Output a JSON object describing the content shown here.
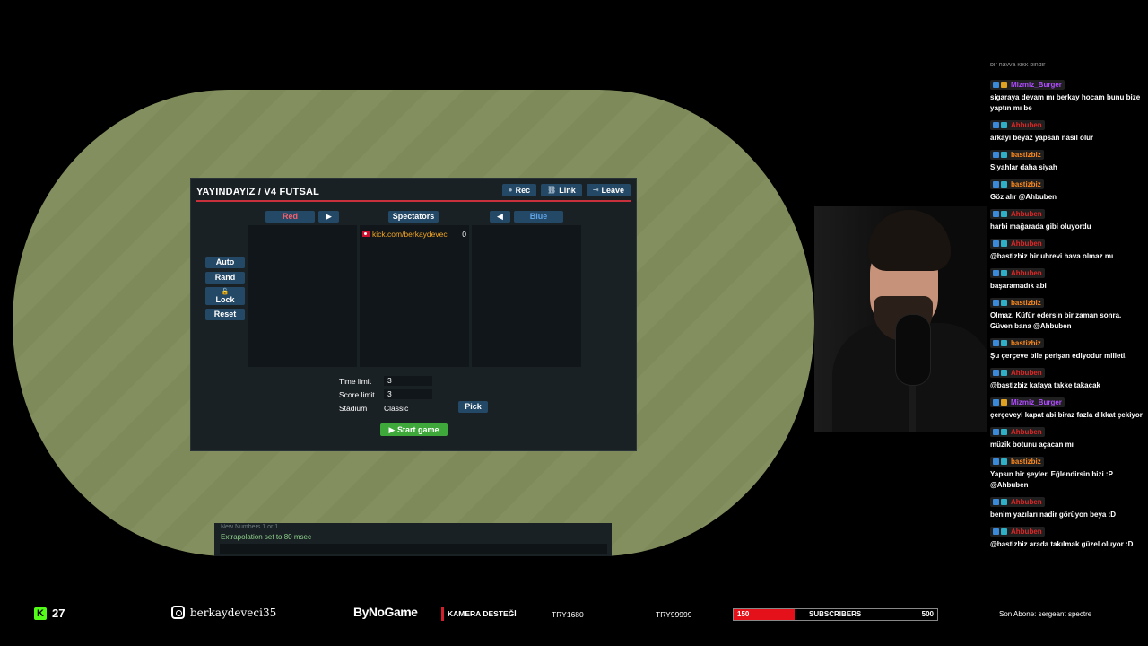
{
  "room": {
    "title": "YAYINDAYIZ / V4 FUTSAL",
    "buttons": {
      "rec": "Rec",
      "link": "Link",
      "leave": "Leave"
    },
    "teams": {
      "red": "Red",
      "spectators": "Spectators",
      "blue": "Blue",
      "red_arrow": "▶",
      "blue_arrow": "◀"
    },
    "spectators": [
      {
        "name": "kick.com/berkaydeveci",
        "score": "0"
      }
    ],
    "side_buttons": {
      "auto": "Auto",
      "rand": "Rand",
      "lock": "Lock",
      "reset": "Reset"
    },
    "options": {
      "time_limit_label": "Time limit",
      "time_limit": "3",
      "score_limit_label": "Score limit",
      "score_limit": "3",
      "stadium_label": "Stadium",
      "stadium": "Classic",
      "pick": "Pick"
    },
    "start": "▶ Start game"
  },
  "log": {
    "line1": "New Numbers 1 or 1",
    "line2": "Extrapolation set to 80 msec"
  },
  "chat": {
    "top": "bir havva kikk bindir",
    "messages": [
      {
        "user": "Mizmiz_Burger",
        "color": "purple",
        "text": "sigaraya devam mı berkay hocam bunu bize yaptın mı be"
      },
      {
        "user": "Ahbuben",
        "color": "red",
        "text": "arkayı beyaz yapsan nasıl olur"
      },
      {
        "user": "bastizbiz",
        "color": "orange",
        "text": "Siyahlar daha siyah"
      },
      {
        "user": "bastizbiz",
        "color": "orange",
        "text": "Göz alır @Ahbuben"
      },
      {
        "user": "Ahbuben",
        "color": "red",
        "text": "harbi mağarada gibi oluyordu"
      },
      {
        "user": "Ahbuben",
        "color": "red",
        "text": "@bastizbiz bir uhrevi hava olmaz mı"
      },
      {
        "user": "Ahbuben",
        "color": "red",
        "text": "başaramadık abi"
      },
      {
        "user": "bastizbiz",
        "color": "orange",
        "text": "Olmaz. Küfür edersin bir zaman sonra. Güven bana @Ahbuben"
      },
      {
        "user": "bastizbiz",
        "color": "orange",
        "text": "Şu çerçeve bile perişan ediyodur milleti."
      },
      {
        "user": "Ahbuben",
        "color": "red",
        "text": "@bastizbiz kafaya takke takacak"
      },
      {
        "user": "Mizmiz_Burger",
        "color": "purple",
        "text": "çerçeveyi kapat abi biraz fazla dikkat çekiyor"
      },
      {
        "user": "Ahbuben",
        "color": "red",
        "text": "müzik botunu açacan mı"
      },
      {
        "user": "bastizbiz",
        "color": "orange",
        "text": "Yapsın bir şeyler. Eğlendirsin bizi :P @Ahbuben"
      },
      {
        "user": "Ahbuben",
        "color": "red",
        "text": "benim yazıları nadir görüyon beya :D"
      },
      {
        "user": "Ahbuben",
        "color": "red",
        "text": "@bastizbiz arada takılmak güzel oluyor :D"
      }
    ]
  },
  "bar": {
    "kick_logo": "K",
    "kick_count": "27",
    "instagram": "berkaydeveci35",
    "bynogame": "ByNoGame",
    "kamera": "KAMERA DESTEĞİ",
    "try1": "TRY1680",
    "try2": "TRY99999",
    "subs_current": "150",
    "subs_label": "SUBSCRIBERS",
    "subs_max": "500",
    "subs_progress": 0.3,
    "son_abone": "Son Abone: sergeant spectre"
  },
  "colors": {
    "purple": "#b04cff",
    "red": "#e02626",
    "orange": "#ff8a1c"
  }
}
